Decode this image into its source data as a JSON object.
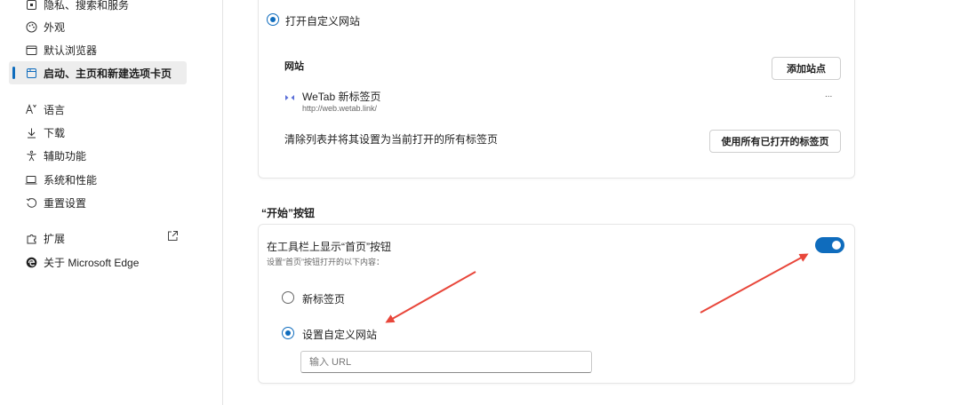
{
  "sidebar": {
    "items": [
      {
        "label": "隐私、搜索和服务",
        "icon": "lock-icon"
      },
      {
        "label": "外观",
        "icon": "palette-icon"
      },
      {
        "label": "默认浏览器",
        "icon": "browser-icon"
      },
      {
        "label": "启动、主页和新建选项卡页",
        "icon": "start-tabs-icon",
        "active": true
      },
      {
        "label": "语言",
        "icon": "language-icon"
      },
      {
        "label": "下载",
        "icon": "download-icon"
      },
      {
        "label": "辅助功能",
        "icon": "accessibility-icon"
      },
      {
        "label": "系统和性能",
        "icon": "laptop-icon"
      },
      {
        "label": "重置设置",
        "icon": "reset-icon"
      },
      {
        "label": "扩展",
        "icon": "extensions-icon"
      },
      {
        "label": "关于 Microsoft Edge",
        "icon": "edge-logo-icon"
      }
    ]
  },
  "startup": {
    "open_custom_label": "打开自定义网站",
    "sites_heading": "网站",
    "add_site_button": "添加站点",
    "site": {
      "title": "WeTab 新标签页",
      "url": "http://web.wetab.link/",
      "more": "..."
    },
    "clear_list_text": "清除列表并将其设置为当前打开的所有标签页",
    "use_open_tabs_button": "使用所有已打开的标签页"
  },
  "home_button": {
    "section_title": "“开始”按钮",
    "show_label": "在工具栏上显示“首页”按钮",
    "sub_label": "设置“首页”按钮打开的以下内容：",
    "toggle_on": true,
    "option_new_tab": "新标签页",
    "option_custom": "设置自定义网站",
    "url_placeholder": "输入 URL"
  },
  "colors": {
    "accent": "#0f6cbd",
    "annotation_arrow": "#e8463a"
  }
}
